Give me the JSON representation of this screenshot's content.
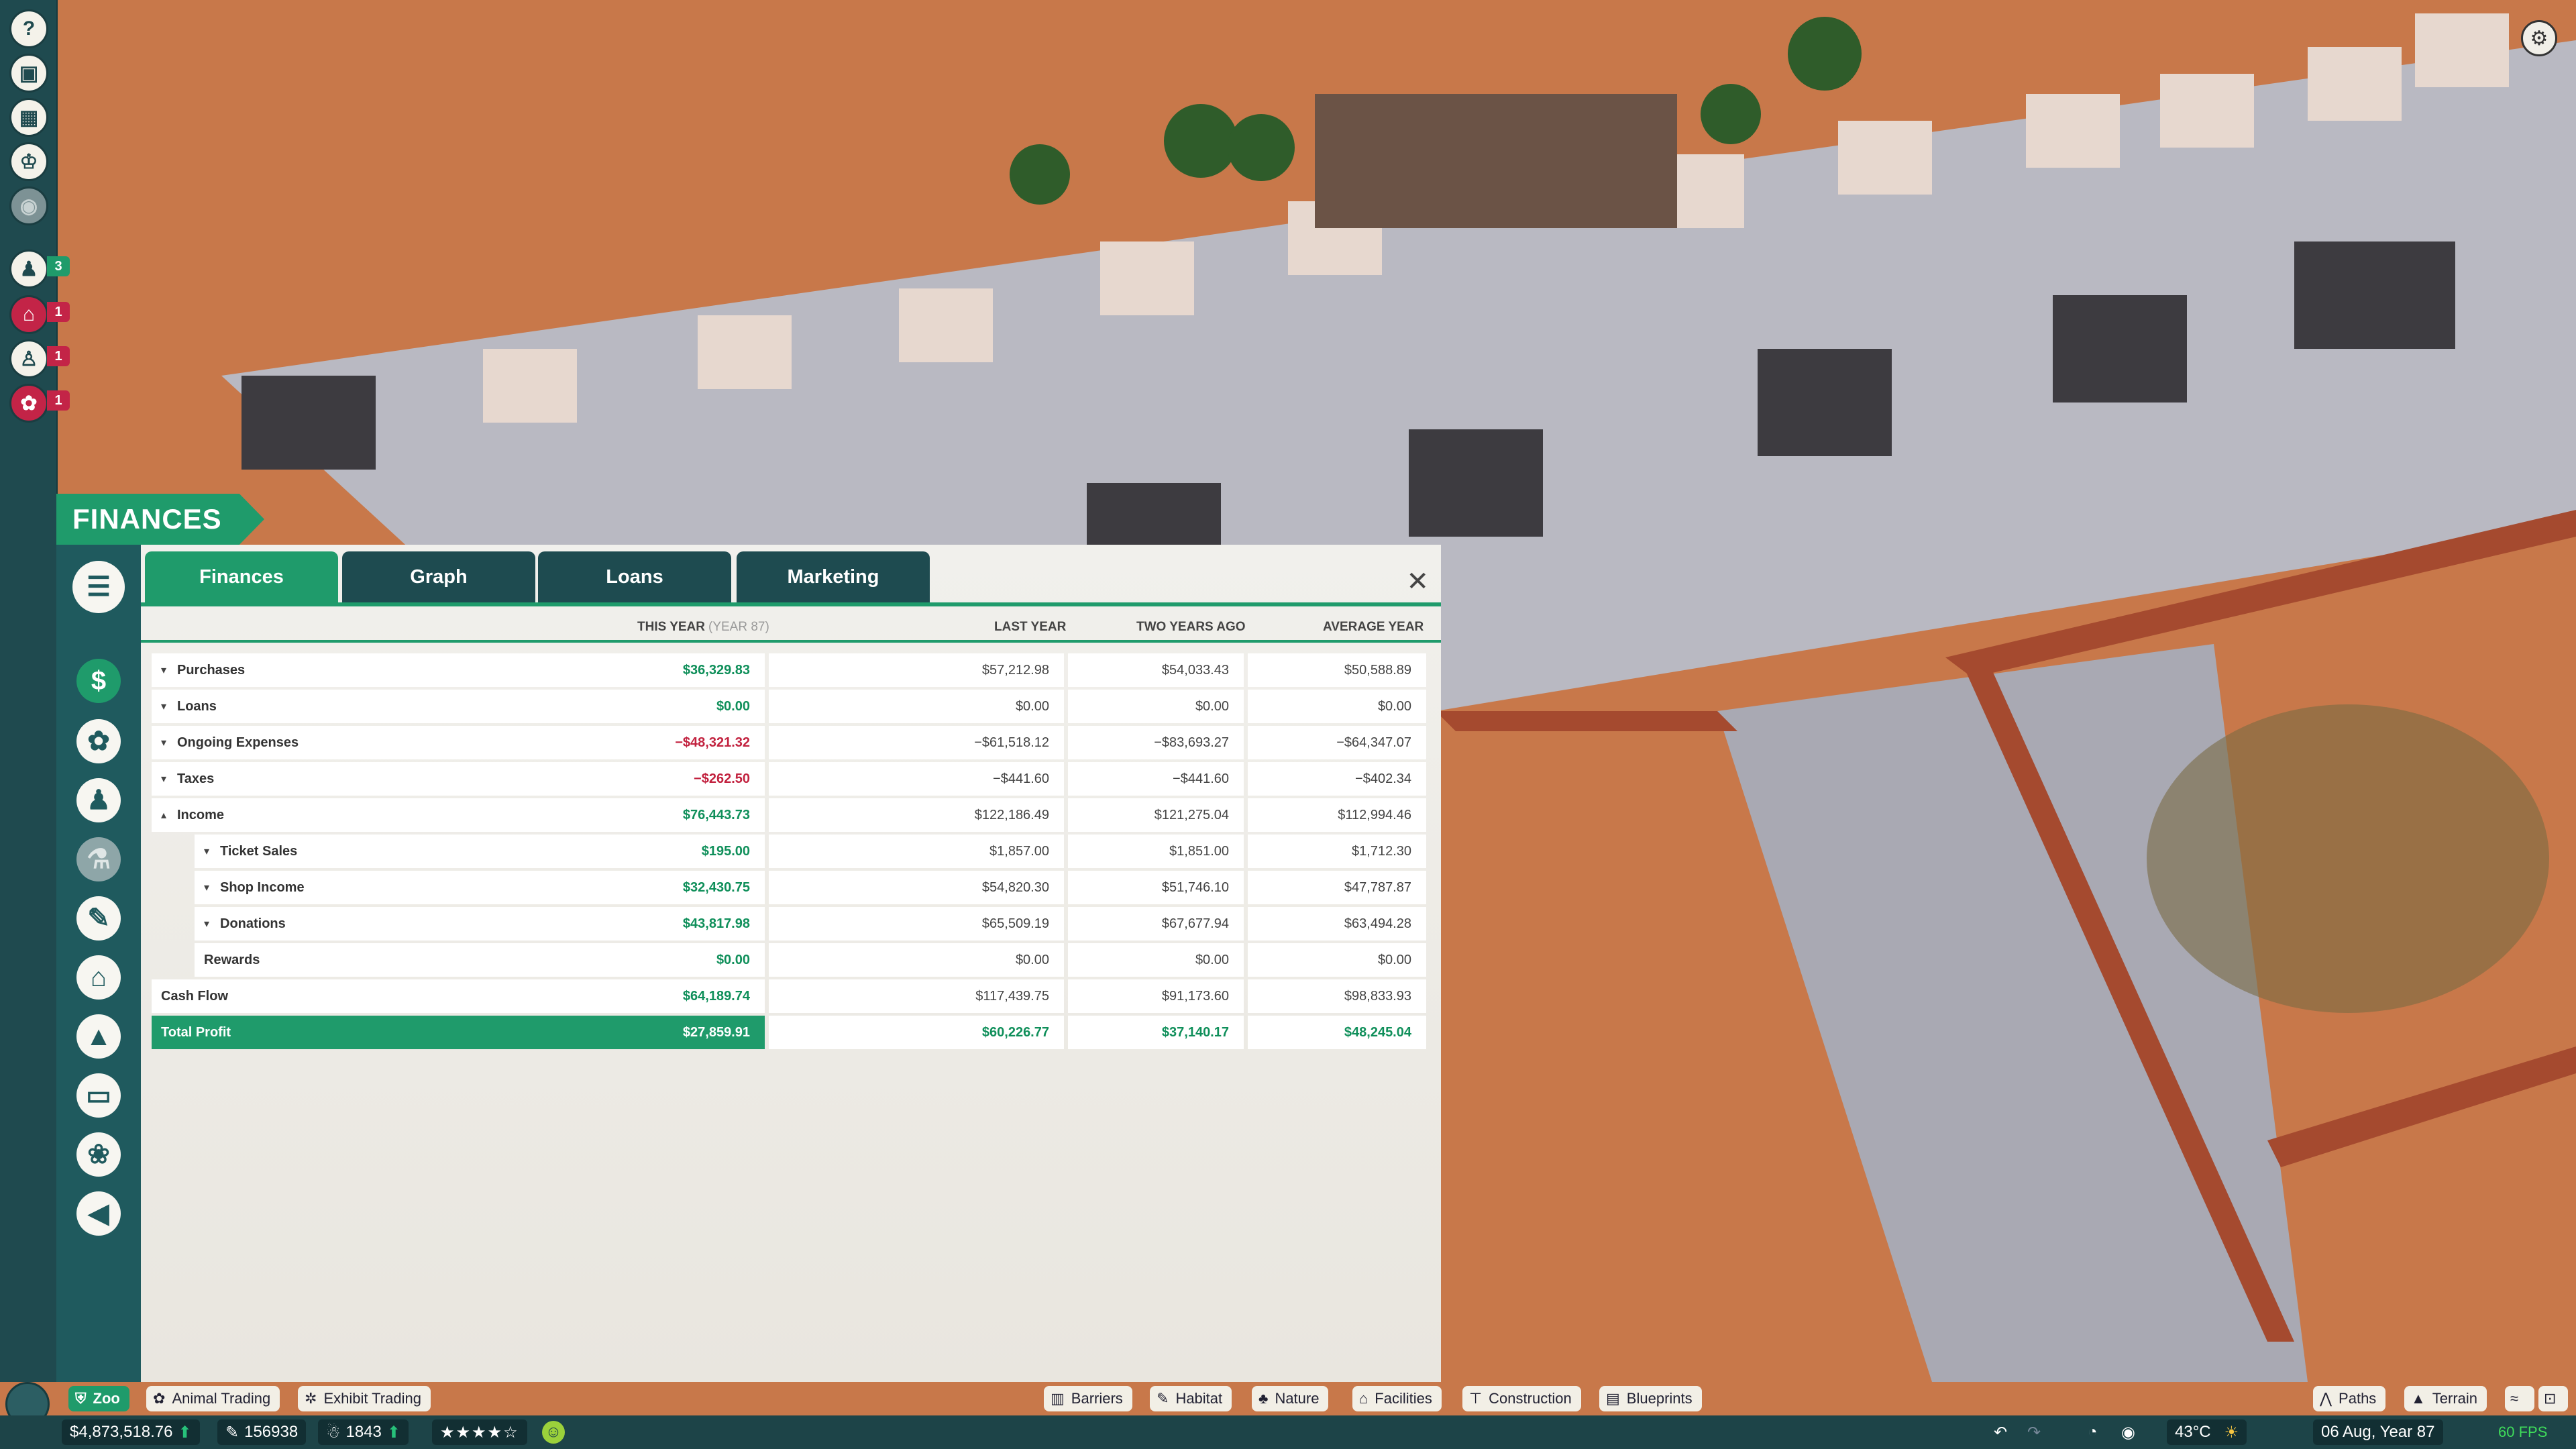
{
  "window": {
    "title": "FINANCES",
    "close_icon": "close-icon"
  },
  "tabs": [
    {
      "label": "Finances",
      "active": true
    },
    {
      "label": "Graph",
      "active": false
    },
    {
      "label": "Loans",
      "active": false
    },
    {
      "label": "Marketing",
      "active": false
    }
  ],
  "columns": {
    "this_year": "THIS YEAR",
    "this_year_suffix": "(YEAR 87)",
    "last_year": "LAST YEAR",
    "two_years_ago": "TWO YEARS AGO",
    "average_year": "AVERAGE YEAR"
  },
  "rows": [
    {
      "name": "Purchases",
      "caret": "▾",
      "this": "$36,329.83",
      "last": "$57,212.98",
      "two": "$54,033.43",
      "avg": "$50,588.89"
    },
    {
      "name": "Loans",
      "caret": "▾",
      "this": "$0.00",
      "last": "$0.00",
      "two": "$0.00",
      "avg": "$0.00"
    },
    {
      "name": "Ongoing Expenses",
      "caret": "▾",
      "this": "−$48,321.32",
      "last": "−$61,518.12",
      "two": "−$83,693.27",
      "avg": "−$64,347.07"
    },
    {
      "name": "Taxes",
      "caret": "▾",
      "this": "−$262.50",
      "last": "−$441.60",
      "two": "−$441.60",
      "avg": "−$402.34"
    },
    {
      "name": "Income",
      "caret": "▴",
      "this": "$76,443.73",
      "last": "$122,186.49",
      "two": "$121,275.04",
      "avg": "$112,994.46"
    },
    {
      "name": "Ticket Sales",
      "caret": "▾",
      "this": "$195.00",
      "last": "$1,857.00",
      "two": "$1,851.00",
      "avg": "$1,712.30"
    },
    {
      "name": "Shop Income",
      "caret": "▾",
      "this": "$32,430.75",
      "last": "$54,820.30",
      "two": "$51,746.10",
      "avg": "$47,787.87"
    },
    {
      "name": "Donations",
      "caret": "▾",
      "this": "$43,817.98",
      "last": "$65,509.19",
      "two": "$67,677.94",
      "avg": "$63,494.28"
    },
    {
      "name": "Rewards",
      "caret": "",
      "this": "$0.00",
      "last": "$0.00",
      "two": "$0.00",
      "avg": "$0.00"
    },
    {
      "name": "Cash Flow",
      "caret": "",
      "this": "$64,189.74",
      "last": "$117,439.75",
      "two": "$91,173.60",
      "avg": "$98,833.93"
    },
    {
      "name": "Total Profit",
      "caret": "",
      "this": "$27,859.91",
      "last": "$60,226.77",
      "two": "$37,140.17",
      "avg": "$48,245.04"
    }
  ],
  "left_strip": {
    "badges": [
      "3",
      "1",
      "1",
      "1"
    ]
  },
  "bottom_tabs": {
    "zoo": "Zoo",
    "animal_trading": "Animal Trading",
    "exhibit_trading": "Exhibit Trading",
    "barriers": "Barriers",
    "habitat": "Habitat",
    "nature": "Nature",
    "facilities": "Facilities",
    "construction": "Construction",
    "blueprints": "Blueprints",
    "paths": "Paths",
    "terrain": "Terrain"
  },
  "status": {
    "money": "$4,873,518.76",
    "conservation": "156938",
    "guests": "1843",
    "rating_stars": 4.5,
    "temperature": "43°C",
    "date": "06 Aug, Year 87",
    "fps": "60 FPS"
  },
  "colors": {
    "accent_green": "#1f9b6b",
    "panel_teal": "#1e4b50",
    "negative_red": "#c2223f",
    "positive_green": "#0f8f5a"
  }
}
